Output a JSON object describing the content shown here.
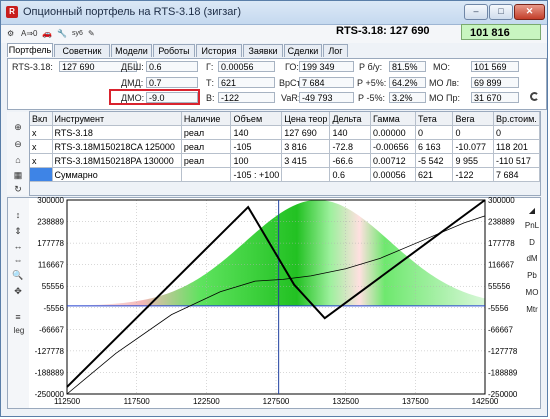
{
  "window": {
    "title": "Опционный портфель на RTS-3.18 (зигзаг)",
    "app_icon": "rts-icon",
    "buttons": [
      "minimize-icon",
      "maximize-icon",
      "close-icon"
    ]
  },
  "toolbar": {
    "items": [
      "gear-icon",
      "a-to-zero-icon",
      "car-icon",
      "wrench-icon",
      "sync-icon",
      "edit-icon"
    ],
    "labels": {
      "a0": "A⇒0",
      "sync": "sy6"
    }
  },
  "header": {
    "title": "RTS-3.18: 127 690",
    "value": "101 816"
  },
  "tabs": [
    "Портфель",
    "Советник",
    "Модели",
    "Роботы",
    "История",
    "Заявки",
    "Сделки",
    "Лог"
  ],
  "active_tab": 0,
  "fields": {
    "underlying_label": "RTS-3.18:",
    "underlying_value": "127 690",
    "dbsh_label": "ДБШ:",
    "dbsh_value": "0.6",
    "dmd_label": "ДМД:",
    "dmd_value": "0.7",
    "dmo_label": "ДМО:",
    "dmo_value": "-9.0",
    "g_label": "Г:",
    "g_value": "0.00056",
    "t_label": "Т:",
    "t_value": "621",
    "v_label": "В:",
    "v_value": "-122",
    "go_label": "ГО:",
    "go_value": "199 349",
    "vrst_label": "ВрСт:",
    "vrst_value": "7 684",
    "var_label": "VaR:",
    "var_value": "-49 793",
    "pbu_label": "Р б/у:",
    "pbu_value": "81.5%",
    "pp5_label": "Р +5%:",
    "pp5_value": "64.2%",
    "pm5_label": "Р -5%:",
    "pm5_value": "3.2%",
    "mo_label": "МО:",
    "mo_value": "101 569",
    "mol_label": "МО Лв:",
    "mol_value": "69 899",
    "mop_label": "МО Пр:",
    "mop_value": "31 670"
  },
  "table": {
    "headers": [
      "Вкл",
      "Инструмент",
      "Наличие",
      "Объем",
      "Цена теор",
      "Дельта",
      "Гамма",
      "Тета",
      "Вега",
      "Вр.стоим."
    ],
    "rows": [
      [
        "x",
        "RTS-3.18",
        "реал",
        "140",
        "127 690",
        "140",
        "0.00000",
        "0",
        "0",
        "0"
      ],
      [
        "x",
        "RTS-3.18M150218CA 125000",
        "реал",
        "-105",
        "3 816",
        "-72.8",
        "-0.00656",
        "6 163",
        "-10.077",
        "118 201"
      ],
      [
        "x",
        "RTS-3.18M150218PA 130000",
        "реал",
        "100",
        "3 415",
        "-66.6",
        "0.00712",
        "-5 542",
        "9 955",
        "-110 517"
      ]
    ],
    "summary": [
      "",
      "Суммарно",
      "",
      "-105 : +100",
      "",
      "0.6",
      "0.00056",
      "621",
      "-122",
      "7 684"
    ]
  },
  "left_tools": [
    "add-row-icon",
    "delete-row-icon",
    "lock-icon",
    "grid-icon",
    "refresh-icon"
  ],
  "chart_tools": [
    "expand-vertical-icon",
    "expand-vertical-icon",
    "expand-horizontal-icon",
    "expand-horizontal-icon",
    "zoom-icon",
    "move-icon",
    "legend-icon"
  ],
  "chart_tool_labels": {
    "leg": "leg"
  },
  "chart_right_buttons": [
    "PnL",
    "D",
    "dM",
    "Pb",
    "MO",
    "Mtr"
  ],
  "chart_data": {
    "type": "line",
    "x_ticks": [
      112500,
      117500,
      122500,
      127500,
      132500,
      137500,
      142500
    ],
    "y_ticks": [
      300000,
      238889,
      177778,
      116667,
      55556,
      -5556,
      -66667,
      -127778,
      -188889,
      -250000
    ],
    "xlim": [
      112500,
      142500
    ],
    "ylim": [
      -250000,
      300000
    ],
    "current_price": 127690,
    "series": [
      {
        "x": [
          112500,
          125500,
          128800,
          131000,
          142500
        ],
        "y": [
          -230000,
          280000,
          60000,
          -35000,
          300000
        ]
      },
      {
        "x": [
          112500,
          116000,
          120000,
          123500,
          126000,
          128000,
          130000,
          132500,
          135000,
          138000,
          141000,
          142500
        ],
        "y": [
          -250000,
          -135000,
          -25000,
          40000,
          70000,
          75000,
          85000,
          105000,
          135000,
          185000,
          235000,
          255000
        ]
      }
    ]
  }
}
